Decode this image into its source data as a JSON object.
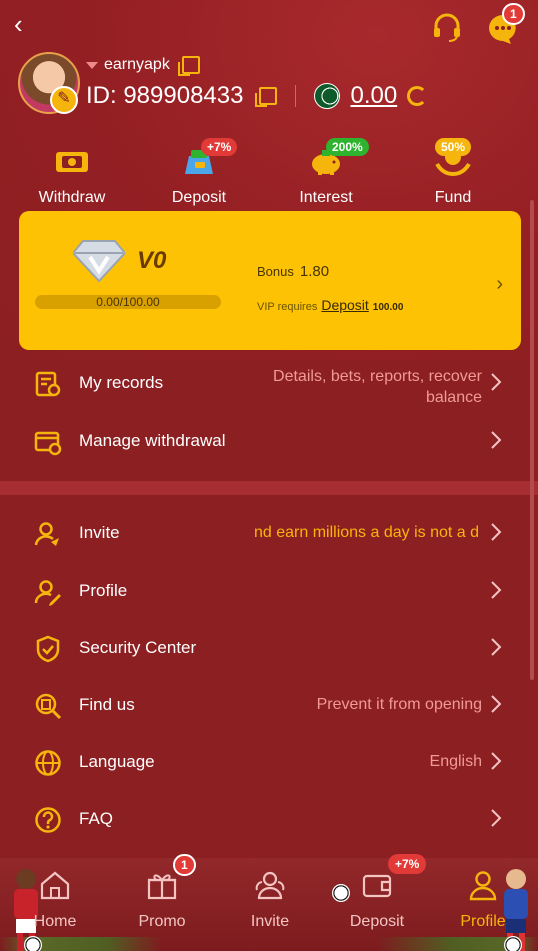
{
  "header": {
    "support_badge": "",
    "message_badge": "1",
    "username": "earnyapk",
    "id_text": "ID: 989908433",
    "balance": "0.00"
  },
  "actions": [
    {
      "label": "Withdraw",
      "icon": "wallet-money-icon",
      "badge": ""
    },
    {
      "label": "Deposit",
      "icon": "money-bag-icon",
      "badge": "+7%"
    },
    {
      "label": "Interest",
      "icon": "piggy-bank-icon",
      "badge": "200%"
    },
    {
      "label": "Fund",
      "icon": "coin-hands-icon",
      "badge": "50%"
    }
  ],
  "vip": {
    "level": "V0",
    "progress_text": "0.00/100.00",
    "progress": 0.0,
    "bonus_label": "Bonus",
    "bonus_value": "1.80",
    "requires_label": "VIP requires",
    "requires_link": "Deposit",
    "requires_amount": "100.00"
  },
  "menu_top": [
    {
      "label": "My records",
      "value": "Details, bets, reports, recover balance",
      "icon": "records-icon"
    },
    {
      "label": "Manage withdrawal",
      "value": "",
      "icon": "withdrawal-card-icon"
    }
  ],
  "menu_bottom": [
    {
      "label": "Invite",
      "value": "nd earn millions a day is not a d",
      "icon": "invite-user-icon"
    },
    {
      "label": "Profile",
      "value": "",
      "icon": "profile-edit-icon"
    },
    {
      "label": "Security Center",
      "value": "",
      "icon": "shield-check-icon"
    },
    {
      "label": "Find us",
      "value": "Prevent it from opening",
      "icon": "search-doc-icon"
    },
    {
      "label": "Language",
      "value": "English",
      "icon": "globe-icon"
    },
    {
      "label": "FAQ",
      "value": "",
      "icon": "question-icon"
    }
  ],
  "nav": [
    {
      "label": "Home",
      "icon": "home-icon",
      "badge": "",
      "active": false
    },
    {
      "label": "Promo",
      "icon": "gift-icon",
      "badge": "1",
      "active": false
    },
    {
      "label": "Invite",
      "icon": "users-icon",
      "badge": "",
      "active": false
    },
    {
      "label": "Deposit",
      "icon": "wallet-icon",
      "badge": "+7%",
      "active": false
    },
    {
      "label": "Profile",
      "icon": "person-icon",
      "badge": "",
      "active": true
    }
  ],
  "colors": {
    "accent": "#f6b50c",
    "background": "#8c1f22",
    "card": "#fcc203",
    "badge_red": "#e23a36",
    "badge_green": "#2db32d"
  }
}
